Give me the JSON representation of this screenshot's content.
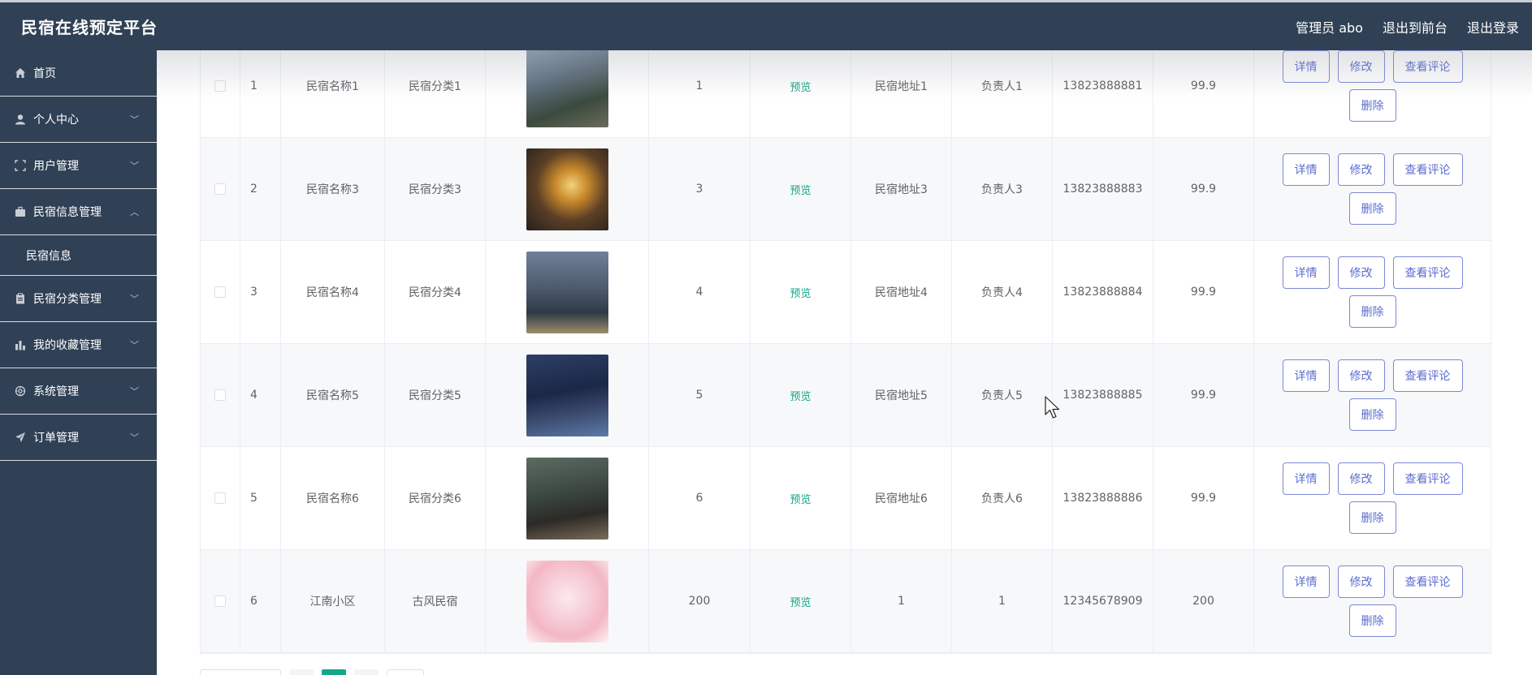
{
  "header": {
    "title": "民宿在线预定平台",
    "user_label": "管理员 abo",
    "to_front_label": "退出到前台",
    "logout_label": "退出登录"
  },
  "sidebar": {
    "items": [
      {
        "label": "首页",
        "icon": "home-icon"
      },
      {
        "label": "个人中心",
        "icon": "user-icon"
      },
      {
        "label": "用户管理",
        "icon": "fullscreen-icon"
      },
      {
        "label": "民宿信息管理",
        "icon": "briefcase-icon",
        "expanded": true
      },
      {
        "label": "民宿分类管理",
        "icon": "clipboard-icon"
      },
      {
        "label": "我的收藏管理",
        "icon": "bar-chart-icon"
      },
      {
        "label": "系统管理",
        "icon": "settings-icon"
      },
      {
        "label": "订单管理",
        "icon": "send-icon"
      }
    ],
    "sub_item": "民宿信息"
  },
  "table": {
    "preview_label": "预览",
    "buttons": {
      "detail": "详情",
      "edit": "修改",
      "comments": "查看评论",
      "delete": "删除"
    },
    "rows": [
      {
        "index": "1",
        "name": "民宿名称1",
        "category": "民宿分类1",
        "count": "1",
        "address": "民宿地址1",
        "owner": "负责人1",
        "phone": "13823888881",
        "price": "99.9"
      },
      {
        "index": "2",
        "name": "民宿名称3",
        "category": "民宿分类3",
        "count": "3",
        "address": "民宿地址3",
        "owner": "负责人3",
        "phone": "13823888883",
        "price": "99.9"
      },
      {
        "index": "3",
        "name": "民宿名称4",
        "category": "民宿分类4",
        "count": "4",
        "address": "民宿地址4",
        "owner": "负责人4",
        "phone": "13823888884",
        "price": "99.9"
      },
      {
        "index": "4",
        "name": "民宿名称5",
        "category": "民宿分类5",
        "count": "5",
        "address": "民宿地址5",
        "owner": "负责人5",
        "phone": "13823888885",
        "price": "99.9"
      },
      {
        "index": "5",
        "name": "民宿名称6",
        "category": "民宿分类6",
        "count": "6",
        "address": "民宿地址6",
        "owner": "负责人6",
        "phone": "13823888886",
        "price": "99.9"
      },
      {
        "index": "6",
        "name": "江南小区",
        "category": "古风民宿",
        "count": "200",
        "address": "1",
        "owner": "1",
        "phone": "12345678909",
        "price": "200"
      }
    ]
  },
  "colors": {
    "sidebar_bg": "#304156",
    "accent_green": "#13a688",
    "button_border": "#7c88d4"
  }
}
